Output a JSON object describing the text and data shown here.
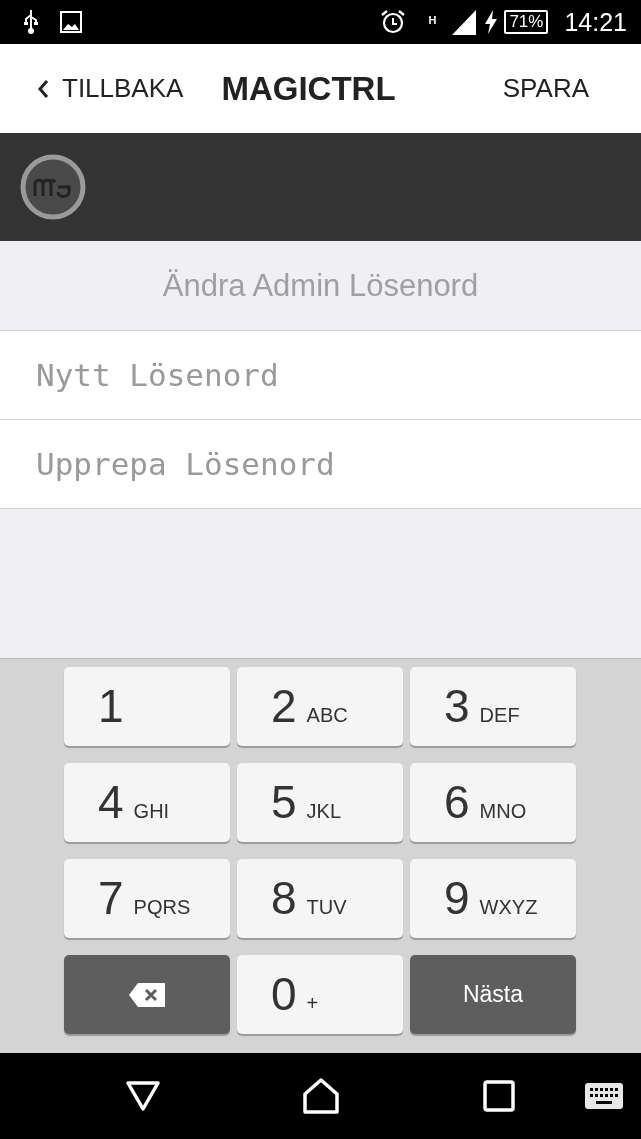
{
  "status_bar": {
    "network": "H",
    "battery": "71%",
    "time": "14:21"
  },
  "nav_bar": {
    "back": "TILLBAKA",
    "title": "MAGICTRL",
    "action": "SPARA"
  },
  "section_title": "Ändra Admin Lösenord",
  "fields": [
    {
      "placeholder": "Nytt Lösenord"
    },
    {
      "placeholder": "Upprepa Lösenord"
    }
  ],
  "keypad": [
    {
      "kind": "digit",
      "digit": "1"
    },
    {
      "kind": "digit",
      "digit": "2",
      "letters": "ABC"
    },
    {
      "kind": "digit",
      "digit": "3",
      "letters": "DEF"
    },
    {
      "kind": "digit",
      "digit": "4",
      "letters": "GHI"
    },
    {
      "kind": "digit",
      "digit": "5",
      "letters": "JKL"
    },
    {
      "kind": "digit",
      "digit": "6",
      "letters": "MNO"
    },
    {
      "kind": "digit",
      "digit": "7",
      "letters": "PQRS"
    },
    {
      "kind": "digit",
      "digit": "8",
      "letters": "TUV"
    },
    {
      "kind": "digit",
      "digit": "9",
      "letters": "WXYZ"
    },
    {
      "kind": "backspace"
    },
    {
      "kind": "digit",
      "digit": "0",
      "letters": "+"
    },
    {
      "kind": "action",
      "label": "Nästa"
    }
  ]
}
